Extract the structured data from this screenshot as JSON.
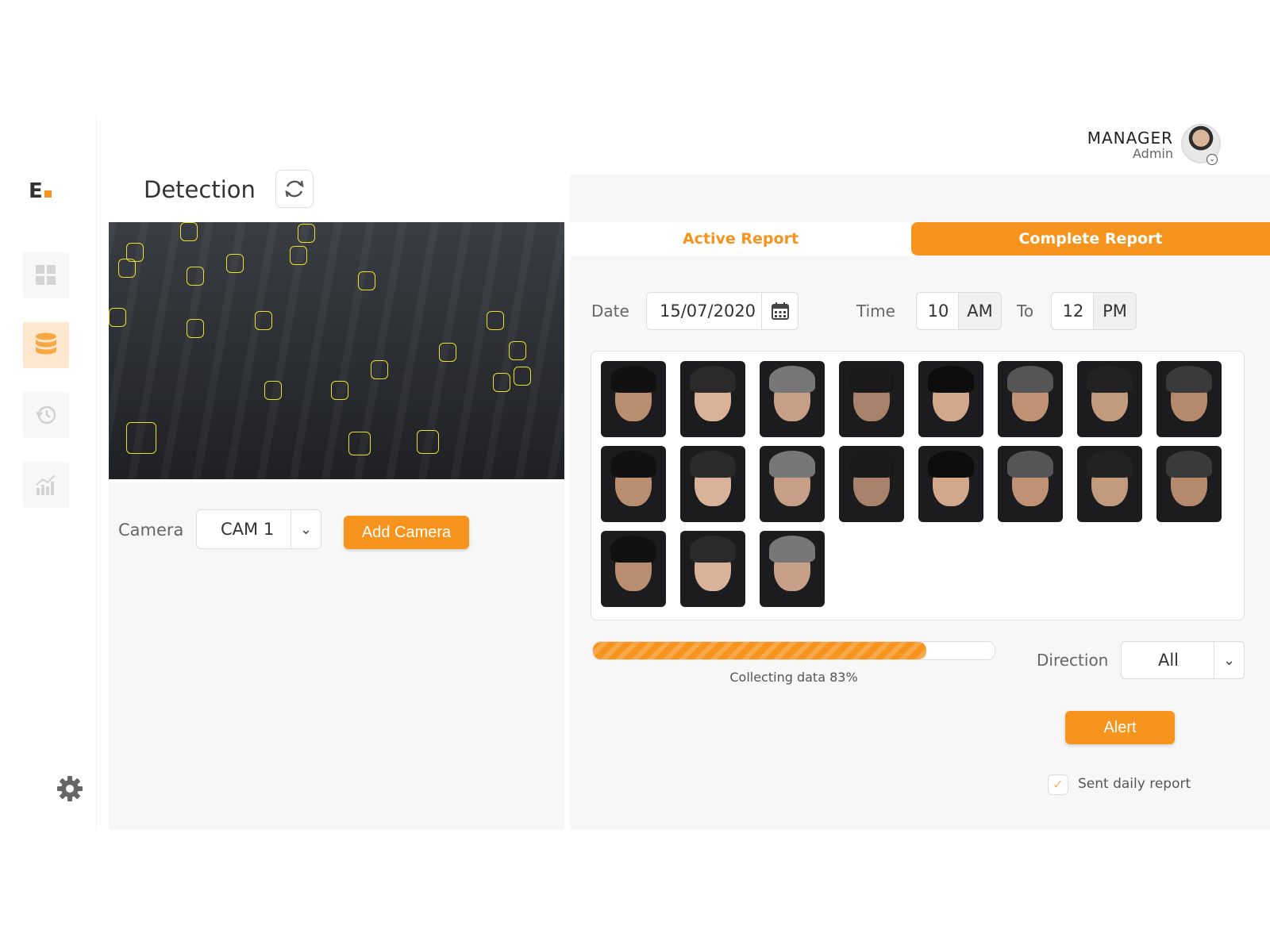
{
  "logo": {
    "letter": "E"
  },
  "header": {
    "user_name": "MANAGER",
    "user_role": "Admin"
  },
  "sidebar": {
    "items": [
      {
        "icon": "dashboard-grid-icon"
      },
      {
        "icon": "database-icon",
        "active": true
      },
      {
        "icon": "history-icon"
      },
      {
        "icon": "analytics-chart-icon"
      }
    ],
    "settings_icon": "gear-icon"
  },
  "detection": {
    "title": "Detection",
    "camera_label": "Camera",
    "camera_value": "CAM 1",
    "add_camera_label": "Add Camera"
  },
  "report": {
    "tabs": [
      {
        "label": "Active Report",
        "selected": false
      },
      {
        "label": "Complete Report",
        "selected": true
      }
    ],
    "date_label": "Date",
    "date_value": "15/07/2020",
    "time_label": "Time",
    "time_from": {
      "value": "10",
      "period": "AM"
    },
    "to_label": "To",
    "time_to": {
      "value": "12",
      "period": "PM"
    },
    "progress": {
      "percent": 83,
      "text": "Collecting data 83%"
    },
    "direction_label": "Direction",
    "direction_value": "All",
    "alert_label": "Alert",
    "daily_report_label": "Sent daily report",
    "daily_report_checked": true
  },
  "colors": {
    "accent": "#f7941d",
    "face_box": "#e8e02a"
  }
}
